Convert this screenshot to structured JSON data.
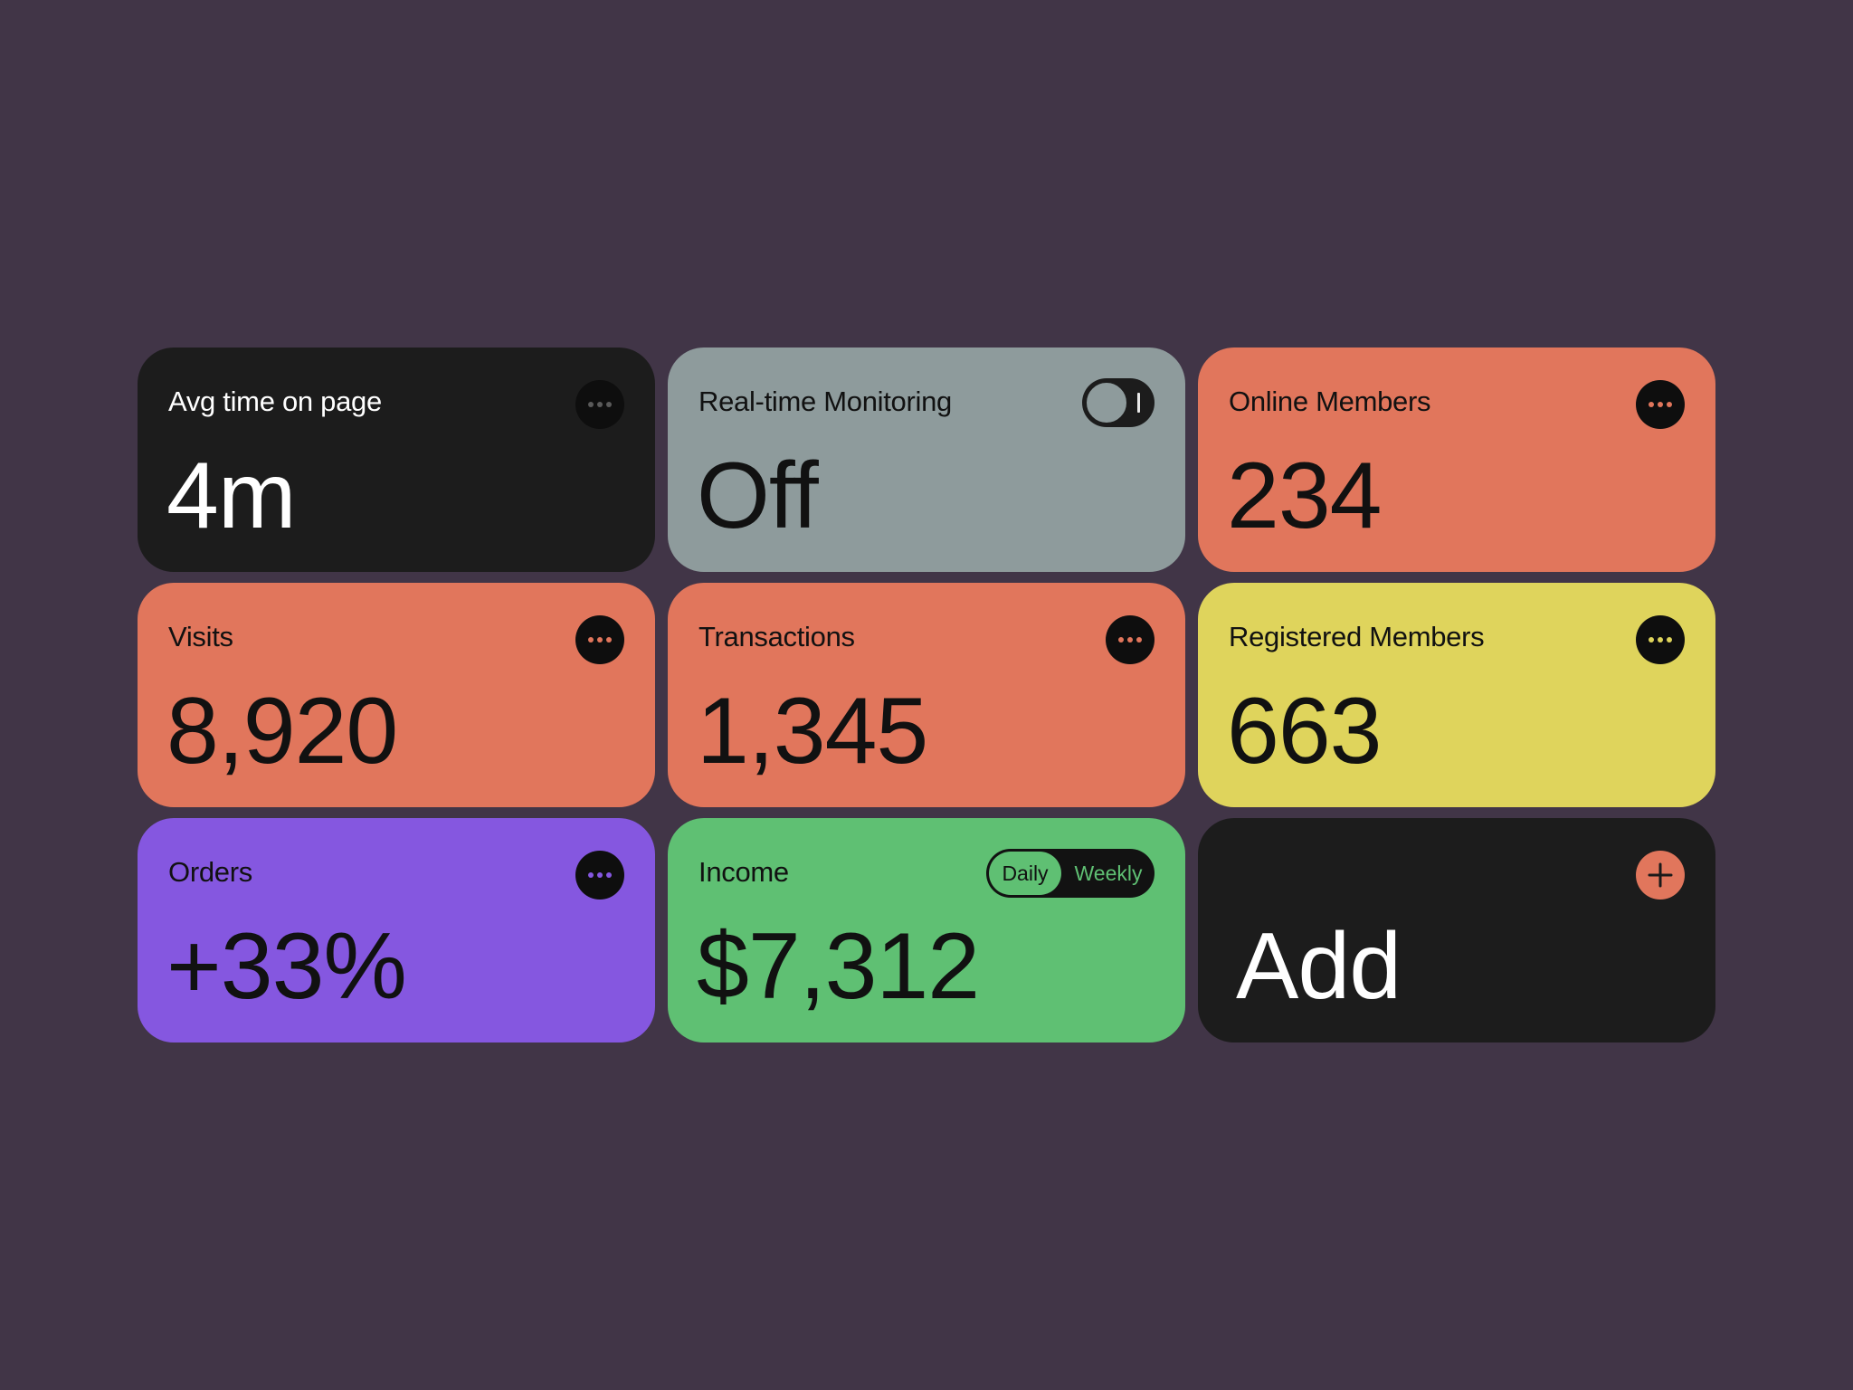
{
  "colors": {
    "background": "#413547",
    "black_card": "#1c1c1c",
    "gray_card": "#8e9b9c",
    "coral_card": "#e1765c",
    "yellow_card": "#dfd45c",
    "purple_card": "#8557e0",
    "green_card": "#5fc073"
  },
  "cards": [
    {
      "title": "Avg time on page",
      "value": "4m",
      "control": "more-icon"
    },
    {
      "title": "Real-time Monitoring",
      "value": "Off",
      "control": "toggle",
      "toggle_on": false
    },
    {
      "title": "Online Members",
      "value": "234",
      "control": "more-icon"
    },
    {
      "title": "Visits",
      "value": "8,920",
      "control": "more-icon"
    },
    {
      "title": "Transactions",
      "value": "1,345",
      "control": "more-icon"
    },
    {
      "title": "Registered Members",
      "value": "663",
      "control": "more-icon"
    },
    {
      "title": "Orders",
      "value": "+33%",
      "control": "more-icon"
    },
    {
      "title": "Income",
      "value": "$7,312",
      "control": "segmented",
      "segments": [
        "Daily",
        "Weekly"
      ],
      "selected_segment": "Daily"
    },
    {
      "title": "",
      "value": "Add",
      "control": "plus-icon"
    }
  ]
}
